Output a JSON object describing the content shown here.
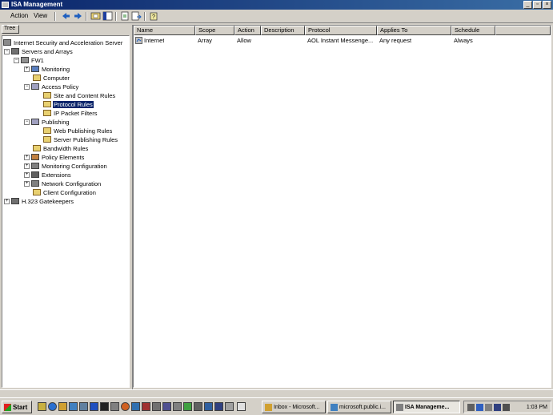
{
  "window": {
    "title": "ISA Management"
  },
  "menu": {
    "action": "Action",
    "view": "View"
  },
  "tree": {
    "header": "Tree",
    "nodes": [
      {
        "label": "Internet Security and Acceleration Server"
      },
      {
        "label": "Servers and Arrays"
      },
      {
        "label": "FW1"
      },
      {
        "label": "Monitoring"
      },
      {
        "label": "Computer"
      },
      {
        "label": "Access Policy"
      },
      {
        "label": "Site and Content Rules"
      },
      {
        "label": "Protocol Rules"
      },
      {
        "label": "IP Packet Filters"
      },
      {
        "label": "Publishing"
      },
      {
        "label": "Web Publishing Rules"
      },
      {
        "label": "Server Publishing Rules"
      },
      {
        "label": "Bandwidth Rules"
      },
      {
        "label": "Policy Elements"
      },
      {
        "label": "Monitoring Configuration"
      },
      {
        "label": "Extensions"
      },
      {
        "label": "Network Configuration"
      },
      {
        "label": "Client Configuration"
      },
      {
        "label": "H.323 Gatekeepers"
      }
    ]
  },
  "list": {
    "columns": [
      "Name",
      "Scope",
      "Action",
      "Description",
      "Protocol",
      "Applies To",
      "Schedule"
    ],
    "rows": [
      {
        "name": "Internet",
        "scope": "Array",
        "action": "Allow",
        "description": "",
        "protocol": "AOL Instant Messenge...",
        "applies_to": "Any request",
        "schedule": "Always"
      }
    ]
  },
  "taskbar": {
    "start": "Start",
    "tasks": [
      {
        "label": "Inbox - Microsoft..."
      },
      {
        "label": "microsoft.public.i..."
      },
      {
        "label": "ISA Manageme..."
      }
    ],
    "clock": "1:03 PM"
  }
}
